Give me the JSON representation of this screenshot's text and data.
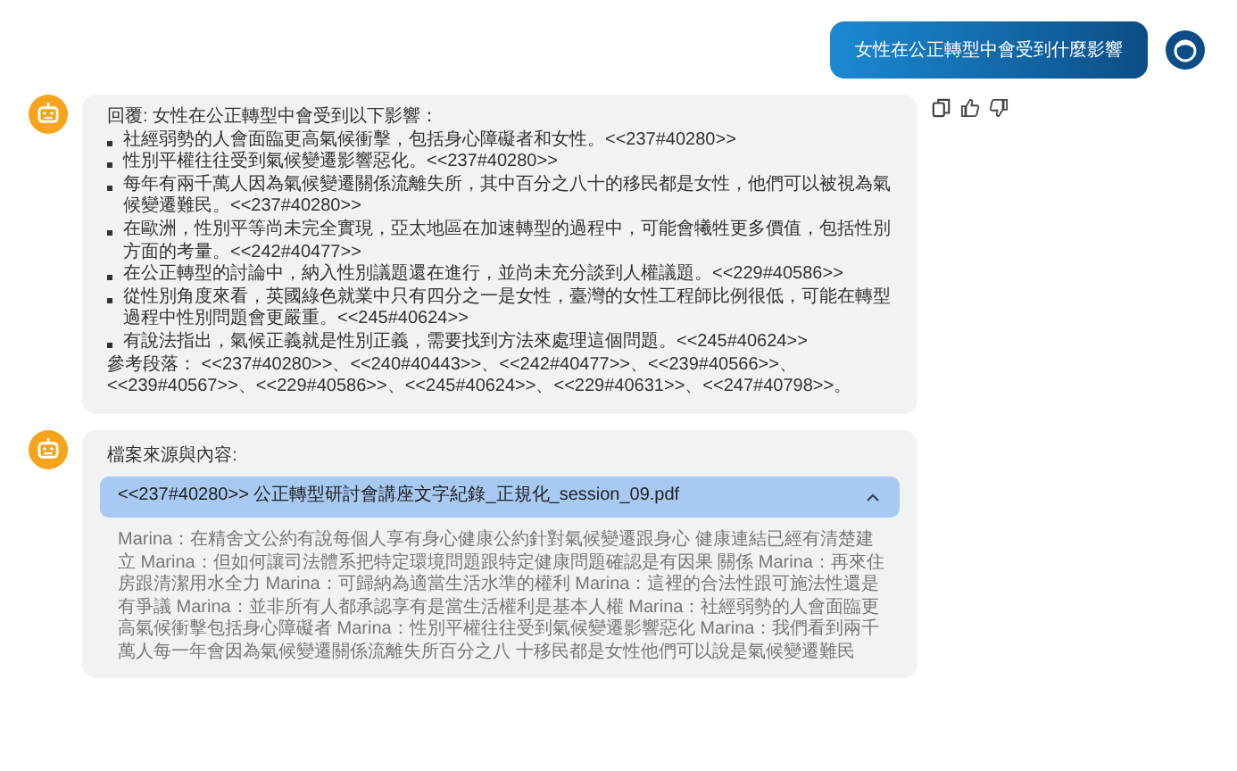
{
  "user_message": {
    "text": "女性在公正轉型中會受到什麼影響"
  },
  "answer": {
    "intro": "回覆: 女性在公正轉型中會受到以下影響：",
    "bullets": [
      "社經弱勢的人會面臨更高氣候衝擊，包括身心障礙者和女性。<<237#40280>>",
      "性別平權往往受到氣候變遷影響惡化。<<237#40280>>",
      "每年有兩千萬人因為氣候變遷關係流離失所，其中百分之八十的移民都是女性，他們可以被視為氣候變遷難民。<<237#40280>>",
      "在歐洲，性別平等尚未完全實現，亞太地區在加速轉型的過程中，可能會犧牲更多價值，包括性別方面的考量。<<242#40477>>",
      "在公正轉型的討論中，納入性別議題還在進行，並尚未充分談到人權議題。<<229#40586>>",
      "從性別角度來看，英國綠色就業中只有四分之一是女性，臺灣的女性工程師比例很低，可能在轉型過程中性別問題會更嚴重。<<245#40624>>",
      "有說法指出，氣候正義就是性別正義，需要找到方法來處理這個問題。<<245#40624>>"
    ],
    "references": "參考段落： <<237#40280>>、<<240#40443>>、<<242#40477>>、<<239#40566>>、<<239#40567>>、<<229#40586>>、<<245#40624>>、<<229#40631>>、<<247#40798>>。"
  },
  "sources": {
    "title": "檔案來源與內容:",
    "file": {
      "label": "<<237#40280>> 公正轉型研討會講座文字紀錄_正規化_session_09.pdf",
      "expanded": true,
      "content": "Marina：在精舍文公約有說每個人享有身心健康公約針對氣候變遷跟身心 健康連結已經有清楚建立 Marina：但如何讓司法體系把特定環境問題跟特定健康問題確認是有因果 關係 Marina：再來住房跟清潔用水全力 Marina：可歸納為適當生活水準的權利 Marina：這裡的合法性跟可施法性還是有爭議 Marina：並非所有人都承認享有是當生活權利是基本人權 Marina：社經弱勢的人會面臨更高氣候衝擊包括身心障礙者 Marina：性別平權往往受到氣候變遷影響惡化 Marina：我們看到兩千萬人每一年會因為氣候變遷關係流離失所百分之八 十移民都是女性他們可以說是氣候變遷難民"
    }
  }
}
